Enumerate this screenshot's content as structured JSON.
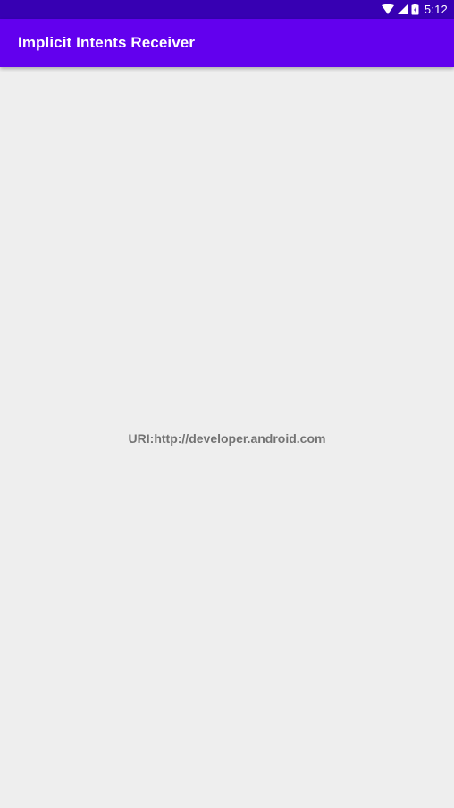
{
  "status_bar": {
    "time": "5:12",
    "icons": [
      "wifi-icon",
      "cell-signal-icon",
      "battery-icon"
    ],
    "background": "#3700b3"
  },
  "app_bar": {
    "title": "Implicit Intents Receiver",
    "background": "#6200ee"
  },
  "content": {
    "uri_text": "URI:http://developer.android.com",
    "background": "#eeeeee"
  }
}
